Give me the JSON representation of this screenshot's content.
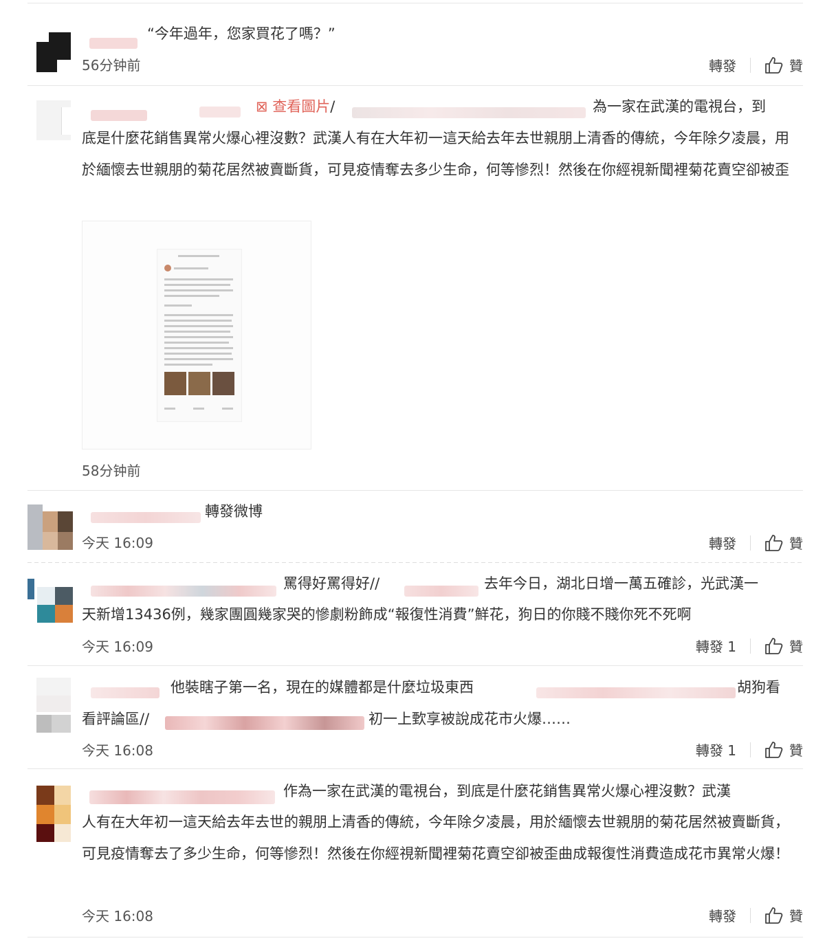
{
  "comments": [
    {
      "id": "c1",
      "text": "“今年過年，您家買花了嗎？”",
      "time": "56分钟前",
      "forward": "轉發",
      "like": "贊"
    },
    {
      "id": "c2",
      "view_image": "查看圖片",
      "line1_tail": "為一家在武漢的電視台，到",
      "body": "底是什麼花銷售異常火爆心裡沒數？武漢人有在大年初一這天給去年去世親朋上清香的傳統，今年除夕凌晨，用於緬懷去世親朋的菊花居然被賣斷貨，可見疫情奪去多少生命，何等慘烈！然後在你經視新聞裡菊花賣空卻被歪",
      "time": "58分钟前"
    },
    {
      "id": "c3",
      "text": "轉發微博",
      "time": "今天 16:09",
      "forward": "轉發",
      "like": "贊"
    },
    {
      "id": "c4",
      "line1_a": "罵得好罵得好//",
      "line1_b": "去年今日，湖北日增一萬五確診，光武漢一",
      "line2": "天新增13436例，幾家團圓幾家哭的慘劇粉飾成“報復性消費”鮮花，狗日的你賤不賤你死不死啊",
      "time": "今天 16:09",
      "forward": "轉發",
      "forward_count": "1",
      "like": "贊"
    },
    {
      "id": "c5",
      "line1_a": "他裝瞎子第一名，現在的媒體都是什麼垃圾東西",
      "line1_b": "胡狗看",
      "line2_a": "看評論區//",
      "line2_b": "初一上歅享被說成花市火爆……",
      "time": "今天 16:08",
      "forward": "轉發",
      "forward_count": "1",
      "like": "贊"
    },
    {
      "id": "c6",
      "line1": "作為一家在武漢的電視台，到底是什麼花銷售異常火爆心裡沒數？武漢",
      "body": "人有在大年初一這天給去年去世的親朋上清香的傳統，今年除夕凌晨，用於緬懷去世親朋的菊花居然被賣斷貨，可見疫情奪去了多少生命，何等慘烈！然後在你經視新聞裡菊花賣空卻被歪曲成報復性消費造成花市異常火爆！",
      "time": "今天 16:08",
      "forward": "轉發",
      "like": "贊"
    }
  ],
  "colors": {
    "accent": "#e0645a",
    "text": "#333333",
    "divider": "#e6e6e6"
  }
}
